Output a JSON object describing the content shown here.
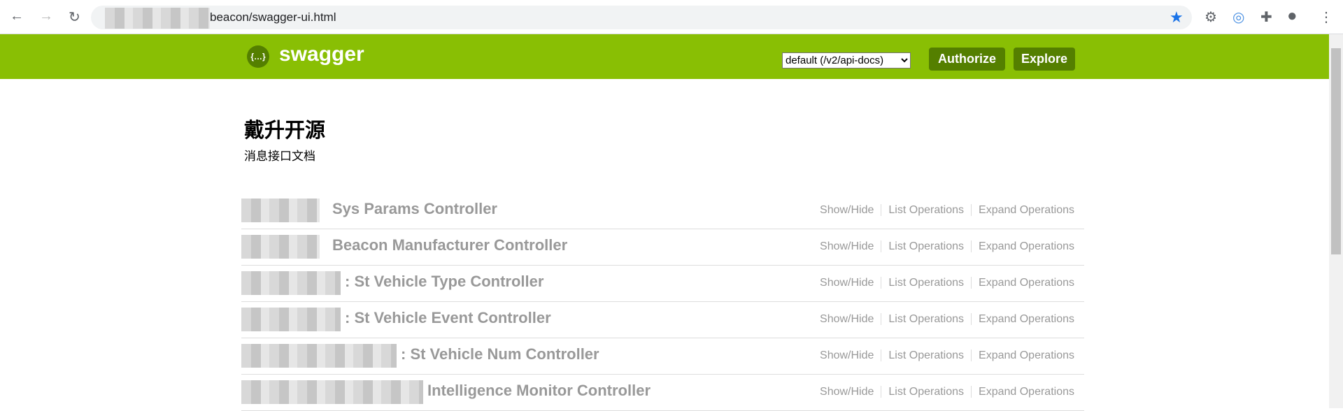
{
  "browser": {
    "url_visible": "beacon/swagger-ui.html"
  },
  "header": {
    "brand": "swagger",
    "logo_text": "{…}",
    "spec_select": "default (/v2/api-docs)",
    "authorize": "Authorize",
    "explore": "Explore",
    "color": "#89bf04",
    "button_color": "#547f00"
  },
  "info": {
    "title": "戴升开源",
    "description": "消息接口文档"
  },
  "controllers": [
    {
      "name": "Sys Params Controller"
    },
    {
      "name": "Beacon Manufacturer Controller"
    },
    {
      "name": ": St Vehicle Type Controller"
    },
    {
      "name": ": St Vehicle Event Controller"
    },
    {
      "name": ": St Vehicle Num Controller"
    },
    {
      "name": "Intelligence Monitor Controller"
    }
  ],
  "row_actions": {
    "show_hide": "Show/Hide",
    "list": "List Operations",
    "expand": "Expand Operations"
  }
}
